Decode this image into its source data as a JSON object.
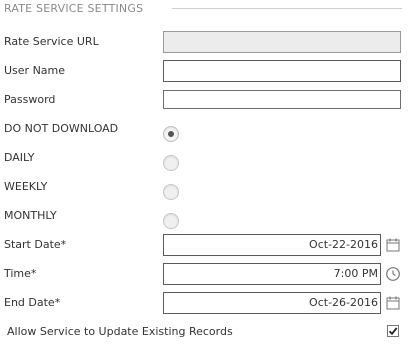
{
  "section": {
    "title": "RATE SERVICE SETTINGS"
  },
  "fields": {
    "rate_service_url": {
      "label": "Rate Service URL",
      "value": ""
    },
    "user_name": {
      "label": "User Name",
      "value": ""
    },
    "password": {
      "label": "Password",
      "value": ""
    }
  },
  "schedule": {
    "options": [
      {
        "label": "DO NOT DOWNLOAD",
        "selected": true
      },
      {
        "label": "DAILY",
        "selected": false
      },
      {
        "label": "WEEKLY",
        "selected": false
      },
      {
        "label": "MONTHLY",
        "selected": false
      }
    ]
  },
  "dates": {
    "start_date": {
      "label": "Start Date*",
      "value": "Oct-22-2016",
      "icon": "calendar-icon"
    },
    "time": {
      "label": "Time*",
      "value": "7:00 PM",
      "icon": "clock-icon"
    },
    "end_date": {
      "label": "End Date*",
      "value": "Oct-26-2016",
      "icon": "calendar-icon"
    }
  },
  "allow_update": {
    "label": "Allow Service to Update Existing Records",
    "checked": true
  }
}
